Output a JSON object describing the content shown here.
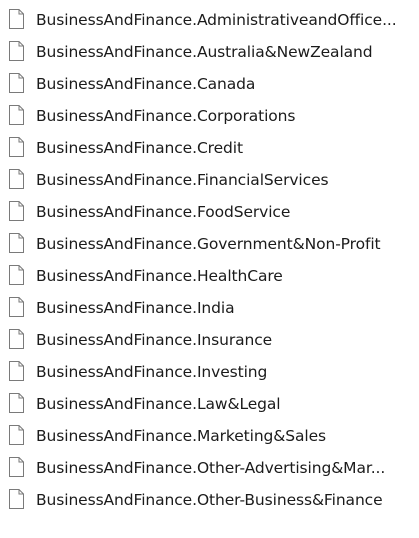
{
  "files": [
    {
      "name": "BusinessAndFinance.AdministrativeandOffice...",
      "icon": "file-icon"
    },
    {
      "name": "BusinessAndFinance.Australia&NewZealand",
      "icon": "file-icon"
    },
    {
      "name": "BusinessAndFinance.Canada",
      "icon": "file-icon"
    },
    {
      "name": "BusinessAndFinance.Corporations",
      "icon": "file-icon"
    },
    {
      "name": "BusinessAndFinance.Credit",
      "icon": "file-icon"
    },
    {
      "name": "BusinessAndFinance.FinancialServices",
      "icon": "file-icon"
    },
    {
      "name": "BusinessAndFinance.FoodService",
      "icon": "file-icon"
    },
    {
      "name": "BusinessAndFinance.Government&Non-Profit",
      "icon": "file-icon"
    },
    {
      "name": "BusinessAndFinance.HealthCare",
      "icon": "file-icon"
    },
    {
      "name": "BusinessAndFinance.India",
      "icon": "file-icon"
    },
    {
      "name": "BusinessAndFinance.Insurance",
      "icon": "file-icon"
    },
    {
      "name": "BusinessAndFinance.Investing",
      "icon": "file-icon"
    },
    {
      "name": "BusinessAndFinance.Law&Legal",
      "icon": "file-icon"
    },
    {
      "name": "BusinessAndFinance.Marketing&Sales",
      "icon": "file-icon"
    },
    {
      "name": "BusinessAndFinance.Other-Advertising&Mar...",
      "icon": "file-icon"
    },
    {
      "name": "BusinessAndFinance.Other-Business&Finance",
      "icon": "file-icon"
    }
  ]
}
